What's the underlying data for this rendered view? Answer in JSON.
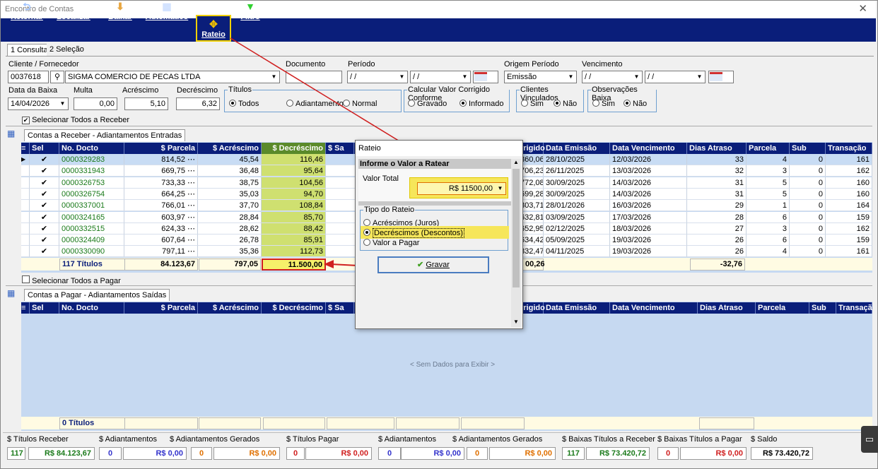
{
  "window": {
    "title": "Encontro de Contas",
    "close": "✕"
  },
  "toolbar": [
    {
      "label": "Retornar",
      "icon": "return-icon",
      "glyph": "⮌"
    },
    {
      "label": "Localizar",
      "icon": "search-icon",
      "glyph": "🔍"
    },
    {
      "label": "Baixar",
      "icon": "download-icon",
      "glyph": "⬇"
    },
    {
      "label": "Automático",
      "icon": "grid-icon",
      "glyph": "▦"
    },
    {
      "label": "Rateio",
      "icon": "move-icon",
      "glyph": "✥"
    },
    {
      "label": "Filtro",
      "icon": "filter-icon",
      "glyph": "▼"
    }
  ],
  "tabs": [
    "1 Consulta",
    "2 Seleção"
  ],
  "form": {
    "cliente_label": "Cliente / Fornecedor",
    "cliente_code": "0037618",
    "cliente_name": "SIGMA COMERCIO DE PECAS LTDA",
    "documento_label": "Documento",
    "periodo_label": "Período",
    "periodo_from": "/ /",
    "periodo_to": "/ /",
    "origem_label": "Origem Período",
    "origem_value": "Emissão",
    "vencimento_label": "Vencimento",
    "venc_from": "/ /",
    "venc_to": "/ /",
    "data_baixa_label": "Data da Baixa",
    "data_baixa": "14/04/2026",
    "multa_label": "Multa",
    "multa": "0,00",
    "acrescimo_label": "Acréscimo",
    "acrescimo": "5,10",
    "decrescimo_label": "Decréscimo",
    "decrescimo": "6,32"
  },
  "groups": {
    "titulos": {
      "title": "Títulos",
      "options": [
        "Todos",
        "Adiantamentos",
        "Normal"
      ]
    },
    "calcular": {
      "title": "Calcular Valor Corrigido Conforme",
      "options": [
        "Gravado",
        "Informado"
      ]
    },
    "vinculados": {
      "title": "Clientes Vinculados",
      "options": [
        "Sim",
        "Não"
      ]
    },
    "observacoes": {
      "title": "Observações Baixa",
      "options": [
        "Sim",
        "Não"
      ]
    }
  },
  "receber": {
    "select_all": "Selecionar Todos a Receber",
    "tab": "Contas a Receber - Adiantamentos Entradas",
    "headers": [
      "Sel",
      "No. Docto",
      "$ Parcela",
      "$ Acréscimo",
      "$ Decréscimo",
      "$ Sa",
      "rrigido",
      "Data Emissão",
      "Data Vencimento",
      "Dias Atraso",
      "Parcela",
      "Sub",
      "Transação"
    ],
    "rows": [
      [
        "0000329283",
        "814,52",
        "45,54",
        "116,46",
        "860,06",
        "28/10/2025",
        "12/03/2026",
        "33",
        "4",
        "0",
        "161"
      ],
      [
        "0000331943",
        "669,75",
        "36,48",
        "95,64",
        "706,23",
        "26/11/2025",
        "13/03/2026",
        "32",
        "3",
        "0",
        "162"
      ],
      [
        "0000326753",
        "733,33",
        "38,75",
        "104,56",
        "772,08",
        "30/09/2025",
        "14/03/2026",
        "31",
        "5",
        "0",
        "160"
      ],
      [
        "0000326754",
        "664,25",
        "35,03",
        "94,70",
        "699,28",
        "30/09/2025",
        "14/03/2026",
        "31",
        "5",
        "0",
        "160"
      ],
      [
        "0000337001",
        "766,01",
        "37,70",
        "108,84",
        "803,71",
        "28/01/2026",
        "16/03/2026",
        "29",
        "1",
        "0",
        "164"
      ],
      [
        "0000324165",
        "603,97",
        "28,84",
        "85,70",
        "632,81",
        "03/09/2025",
        "17/03/2026",
        "28",
        "6",
        "0",
        "159"
      ],
      [
        "0000332515",
        "624,33",
        "28,62",
        "88,42",
        "652,95",
        "02/12/2025",
        "18/03/2026",
        "27",
        "3",
        "0",
        "162"
      ],
      [
        "0000324409",
        "607,64",
        "26,78",
        "85,91",
        "634,42",
        "05/09/2025",
        "19/03/2026",
        "26",
        "6",
        "0",
        "159"
      ],
      [
        "0000330090",
        "797,11",
        "35,36",
        "112,73",
        "832,47",
        "04/11/2025",
        "19/03/2026",
        "26",
        "4",
        "0",
        "161"
      ]
    ],
    "footer": {
      "count": "117 Títulos",
      "parcela": "84.123,67",
      "acrescimo": "797,05",
      "decrescimo": "11.500,00",
      "corrigido": "00,26",
      "dias": "-32,76"
    }
  },
  "pagar": {
    "select_all": "Selecionar Todos a Pagar",
    "tab": "Contas a Pagar - Adiantamentos Saídas",
    "headers": [
      "Sel",
      "No. Docto",
      "$ Parcela",
      "$ Acréscimo",
      "$ Decréscimo",
      "$ Sa",
      "rrigido",
      "Data Emissão",
      "Data Vencimento",
      "Dias Atraso",
      "Parcela",
      "Sub",
      "Transaçã"
    ],
    "empty": "< Sem Dados para Exibir >",
    "footer": {
      "count": "0 Títulos"
    }
  },
  "dialog": {
    "title": "Rateio",
    "section": "Informe o Valor a Ratear",
    "valor_label": "Valor Total",
    "valor": "R$ 11500,00",
    "tipo_title": "Tipo do Rateio",
    "options": [
      "Acréscimos (Juros)",
      "Decréscimos (Descontos)",
      "Valor a Pagar"
    ],
    "button": "Gravar"
  },
  "bottom": {
    "labels": [
      "$ Títulos Receber",
      "$ Adiantamentos",
      "$ Adiantamentos Gerados",
      "$ Títulos Pagar",
      "$ Adiantamentos",
      "$ Adiantamentos Gerados",
      "$ Baixas Títulos a Receber",
      "$ Baixas Títulos a Pagar",
      "$ Saldo"
    ],
    "values": [
      {
        "n": "117",
        "v": "R$ 84.123,67",
        "c": "#1a7a1a"
      },
      {
        "n": "0",
        "v": "R$ 0,00",
        "c": "#3333cc"
      },
      {
        "n": "0",
        "v": "R$ 0,00",
        "c": "#e07000"
      },
      {
        "n": "0",
        "v": "R$ 0,00",
        "c": "#d02020"
      },
      {
        "n": "0",
        "v": "R$ 0,00",
        "c": "#3333cc"
      },
      {
        "n": "0",
        "v": "R$ 0,00",
        "c": "#e07000"
      },
      {
        "n": "117",
        "v": "R$ 73.420,72",
        "c": "#1a7a1a"
      },
      {
        "n": "0",
        "v": "R$ 0,00",
        "c": "#d02020"
      },
      {
        "n": "",
        "v": "R$ 73.420,72",
        "c": "#000000"
      }
    ]
  }
}
